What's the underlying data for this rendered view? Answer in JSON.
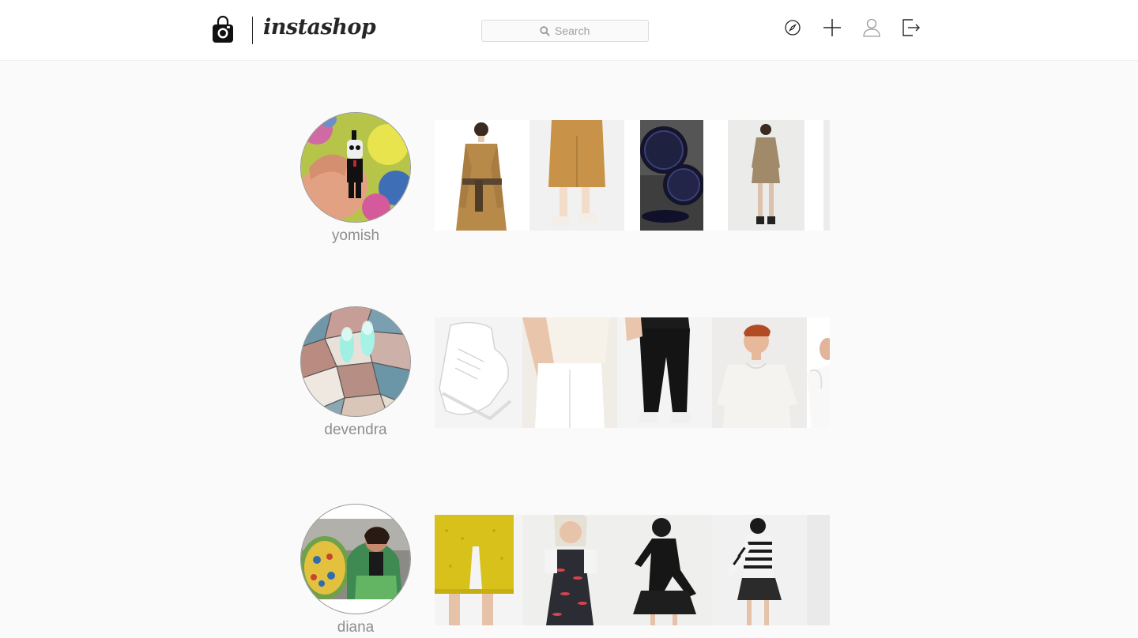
{
  "app": {
    "name": "instashop"
  },
  "search": {
    "placeholder": "Search"
  },
  "nav": {
    "icons": [
      "compass-icon",
      "plus-icon",
      "user-icon",
      "logout-icon"
    ]
  },
  "profiles": [
    {
      "username": "yomish"
    },
    {
      "username": "devendra"
    },
    {
      "username": "diana"
    }
  ],
  "colors": {
    "background": "#fafafa",
    "topbar": "#ffffff",
    "text_dark": "#262626",
    "text_muted": "#8e8e8e",
    "border": "#dbdbdb"
  }
}
